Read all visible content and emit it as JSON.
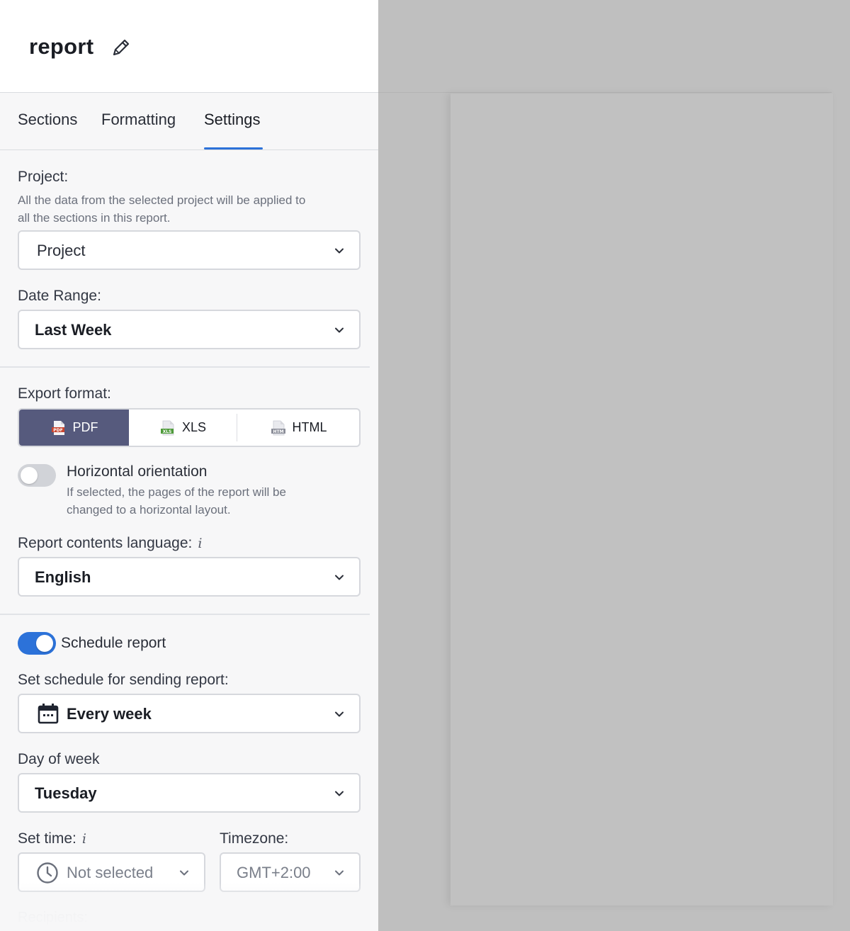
{
  "header": {
    "title": "report"
  },
  "tabs": [
    {
      "label": "Sections"
    },
    {
      "label": "Formatting"
    },
    {
      "label": "Settings"
    }
  ],
  "project": {
    "label": "Project:",
    "description_line1": "All the data from the selected project will be applied to",
    "description_line2": "all the sections in this report.",
    "value": "Project"
  },
  "date_range": {
    "label": "Date Range:",
    "value": "Last Week"
  },
  "export": {
    "label": "Export format:",
    "options": [
      {
        "label": "PDF",
        "icon_text": "PDF"
      },
      {
        "label": "XLS",
        "icon_text": "XLS"
      },
      {
        "label": "HTML",
        "icon_text": "HTM"
      }
    ],
    "selected": "PDF"
  },
  "orientation": {
    "label": "Horizontal orientation",
    "description_line1": "If selected, the pages of the report will be",
    "description_line2": "changed to a horizontal layout.",
    "enabled": false
  },
  "language": {
    "label": "Report contents language:",
    "info": "i",
    "value": "English"
  },
  "schedule": {
    "toggle_label": "Schedule report",
    "enabled": true,
    "frequency_label": "Set schedule for sending report:",
    "frequency_value": "Every week",
    "day_label": "Day of week",
    "day_value": "Tuesday",
    "time_label": "Set time:",
    "time_info": "i",
    "time_value": "Not selected",
    "timezone_label": "Timezone:",
    "timezone_value": "GMT+2:00",
    "recipients_label": "Recipients:"
  },
  "colors": {
    "accent": "#2c72d9",
    "segment_active": "#565a7d",
    "overlay": "#bfbfbf"
  }
}
